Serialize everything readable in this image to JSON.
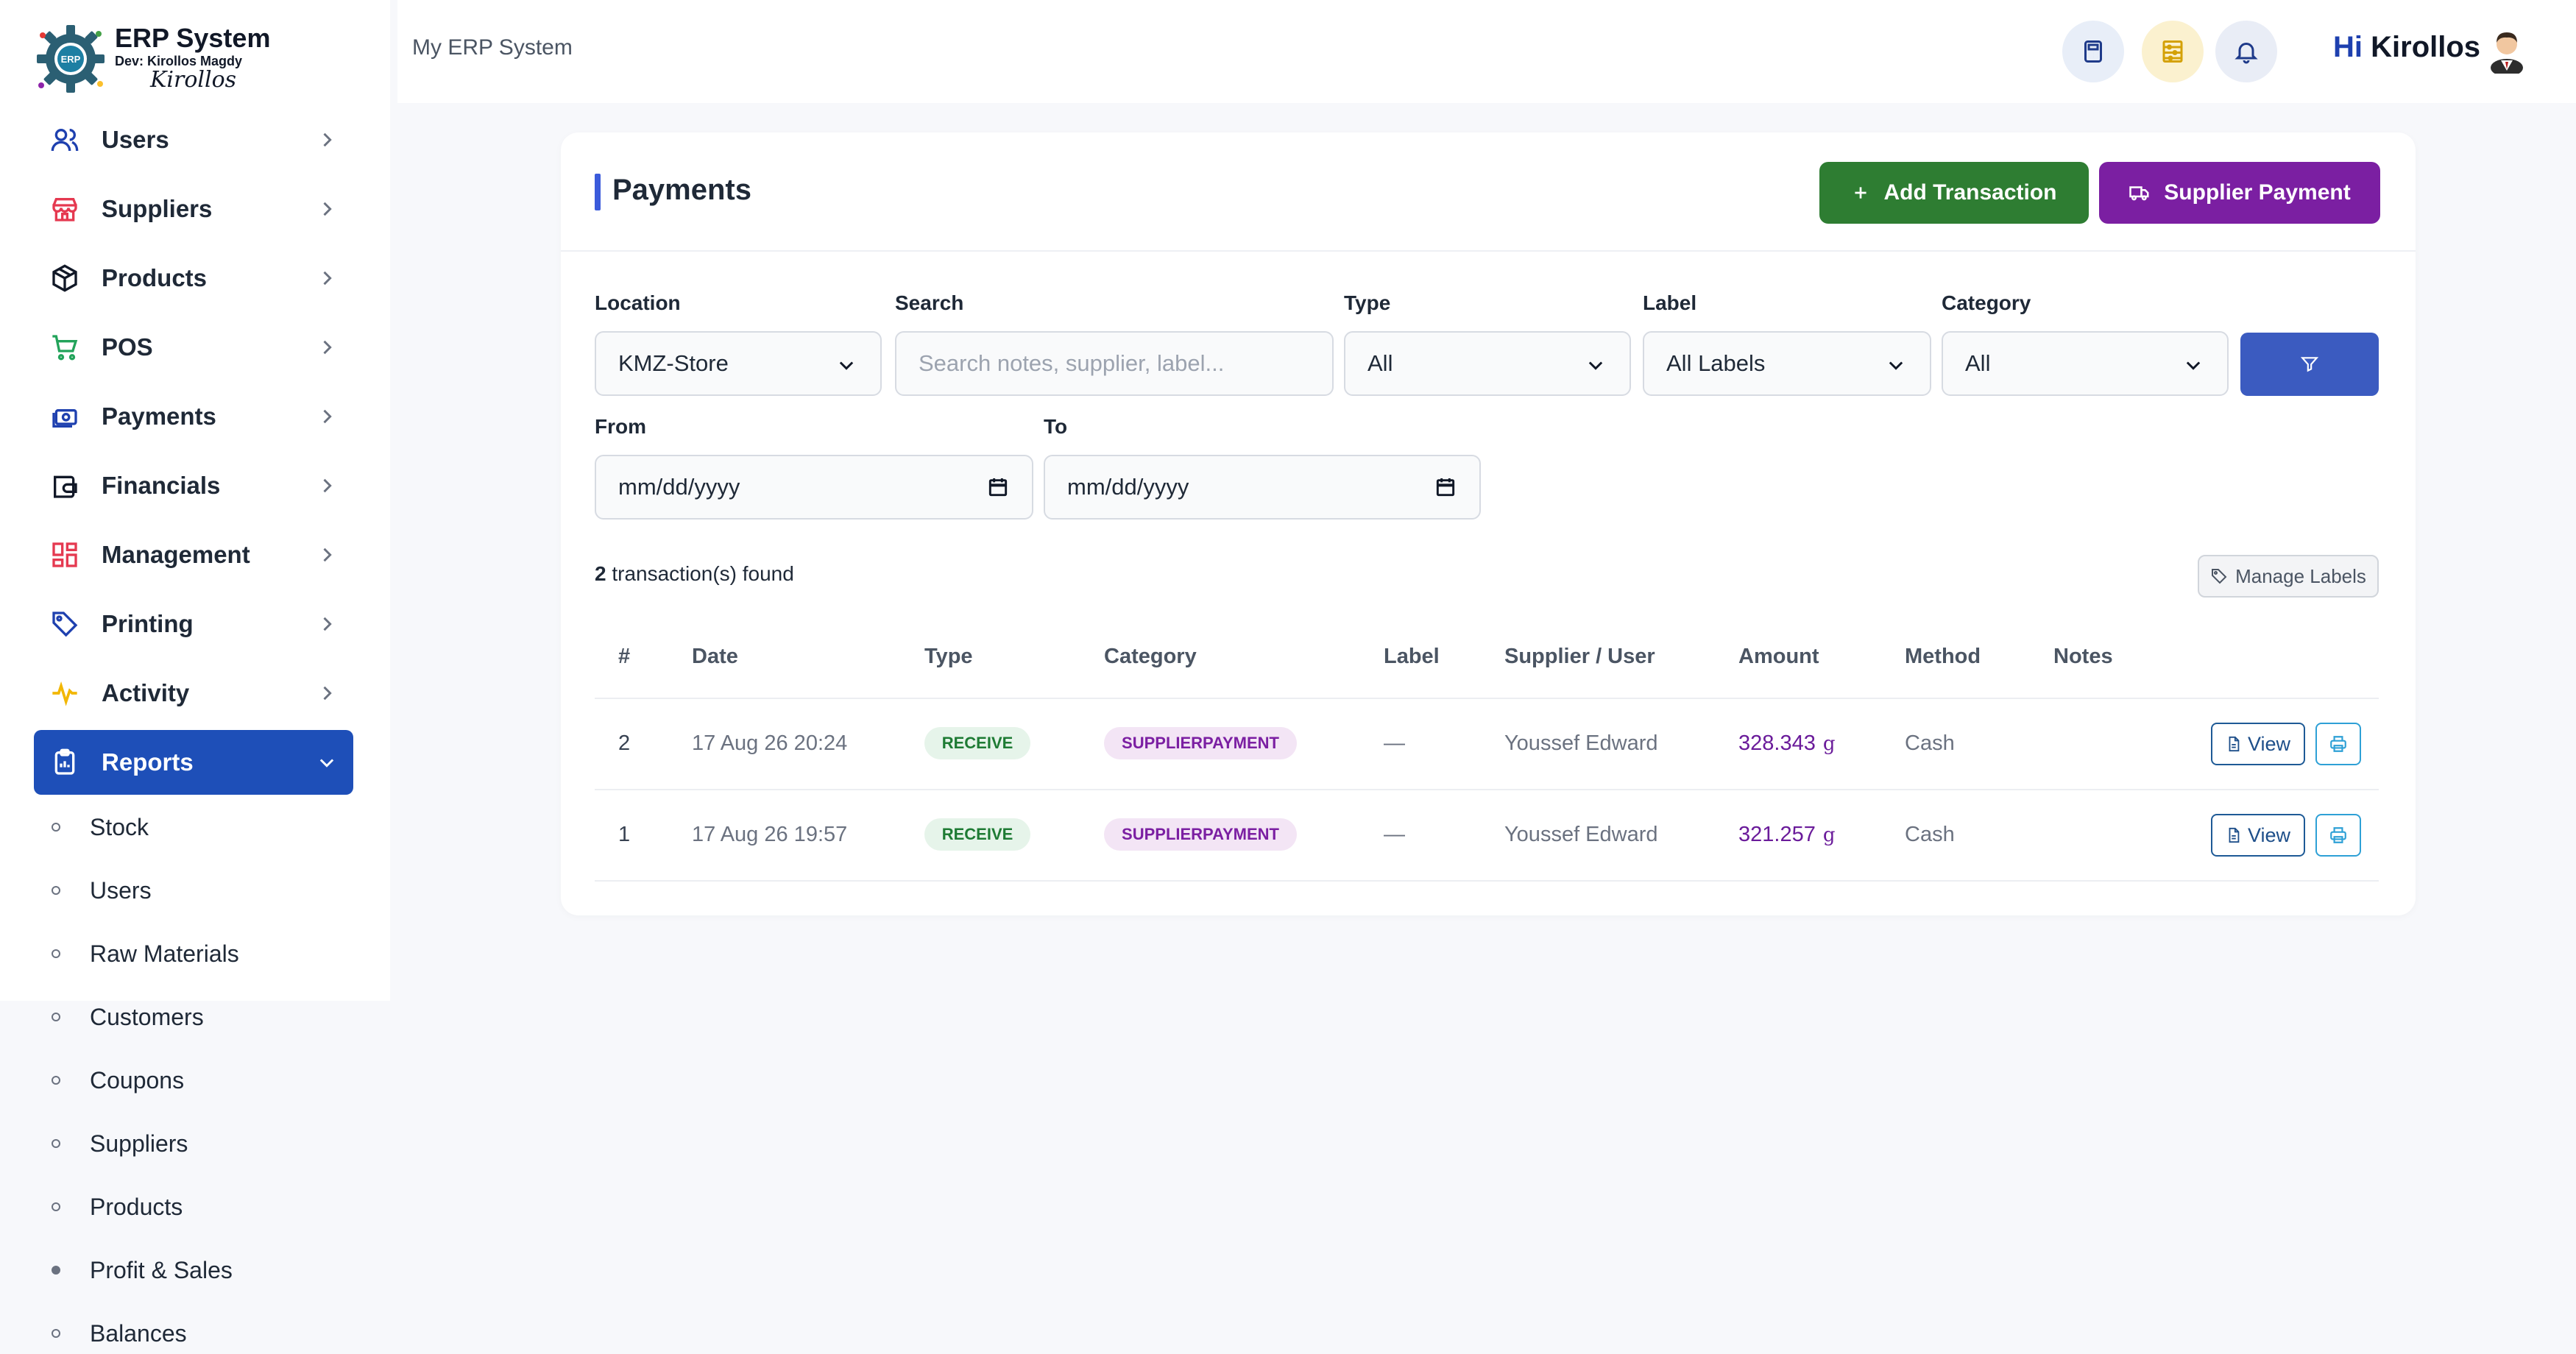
{
  "app": {
    "logo_title": "ERP System",
    "logo_dev": "Dev: Kirollos Magdy",
    "logo_signature": "Kirollos",
    "logo_badge": "ERP"
  },
  "sidebar": {
    "items": [
      {
        "label": "Users",
        "icon": "users-icon"
      },
      {
        "label": "Suppliers",
        "icon": "store-icon"
      },
      {
        "label": "Products",
        "icon": "box-icon"
      },
      {
        "label": "POS",
        "icon": "cart-icon"
      },
      {
        "label": "Payments",
        "icon": "cash-icon"
      },
      {
        "label": "Financials",
        "icon": "wallet-icon"
      },
      {
        "label": "Management",
        "icon": "grid-icon"
      },
      {
        "label": "Printing",
        "icon": "tag-icon"
      },
      {
        "label": "Activity",
        "icon": "pulse-icon"
      },
      {
        "label": "Reports",
        "icon": "clipboard-icon",
        "active": true
      }
    ],
    "sub_items": [
      "Stock",
      "Users",
      "Raw Materials",
      "Customers",
      "Coupons",
      "Suppliers",
      "Products",
      "Profit & Sales",
      "Balances"
    ]
  },
  "topbar": {
    "title": "My ERP System",
    "greeting_hi": "Hi",
    "greeting_name": "Kirollos"
  },
  "page": {
    "title": "Payments",
    "add_transaction_label": "Add Transaction",
    "supplier_payment_label": "Supplier Payment"
  },
  "filters": {
    "location_label": "Location",
    "location_value": "KMZ-Store",
    "search_label": "Search",
    "search_placeholder": "Search notes, supplier, label...",
    "type_label": "Type",
    "type_value": "All",
    "label_label": "Label",
    "label_value": "All Labels",
    "category_label": "Category",
    "category_value": "All",
    "from_label": "From",
    "from_value": "mm/dd/yyyy",
    "to_label": "To",
    "to_value": "mm/dd/yyyy"
  },
  "results": {
    "count": "2",
    "found_text": "transaction(s) found",
    "manage_labels": "Manage Labels"
  },
  "table": {
    "headers": [
      "#",
      "Date",
      "Type",
      "Category",
      "Label",
      "Supplier / User",
      "Amount",
      "Method",
      "Notes"
    ],
    "rows": [
      {
        "num": "2",
        "date": "17 Aug 26 20:24",
        "type": "RECEIVE",
        "category": "SUPPLIERPAYMENT",
        "label": "—",
        "supplier": "Youssef Edward",
        "amount": "328.343",
        "unit": "g",
        "method": "Cash",
        "notes": "",
        "view": "View"
      },
      {
        "num": "1",
        "date": "17 Aug 26 19:57",
        "type": "RECEIVE",
        "category": "SUPPLIERPAYMENT",
        "label": "—",
        "supplier": "Youssef Edward",
        "amount": "321.257",
        "unit": "g",
        "method": "Cash",
        "notes": "",
        "view": "View"
      }
    ]
  },
  "colors": {
    "primary": "#1e4fb8",
    "green": "#2e7d32",
    "purple": "#7b1fa2",
    "filter": "#3b5bc0"
  }
}
